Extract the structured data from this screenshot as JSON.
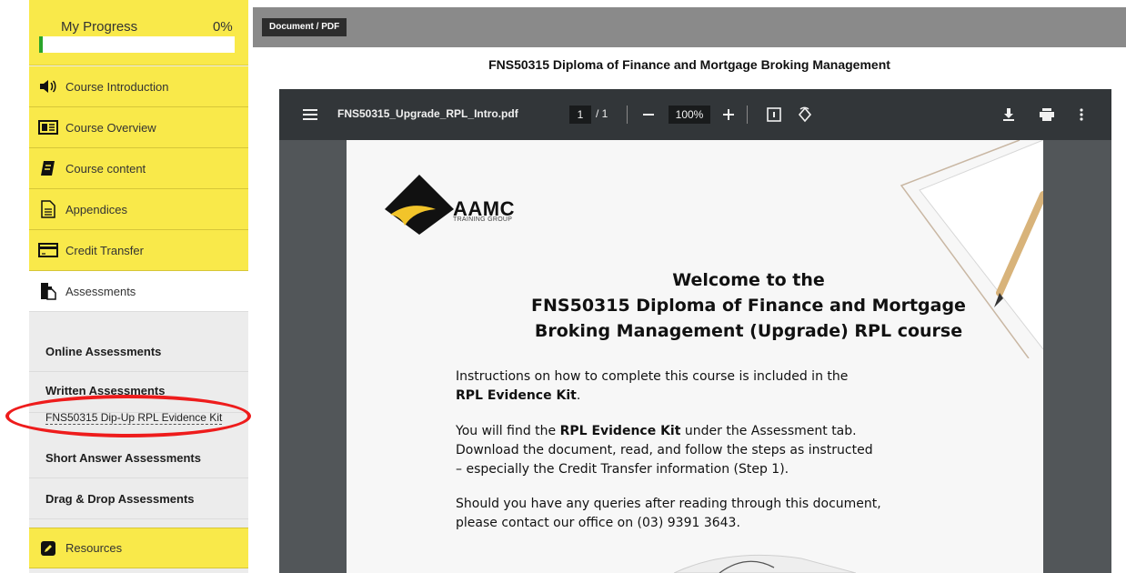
{
  "progress": {
    "title": "My Progress",
    "percent_label": "0%",
    "percent": 0
  },
  "menu": [
    {
      "label": "Course Introduction",
      "icon": "speaker-icon"
    },
    {
      "label": "Course Overview",
      "icon": "newspaper-icon"
    },
    {
      "label": "Course content",
      "icon": "book-icon"
    },
    {
      "label": "Appendices",
      "icon": "document-icon"
    },
    {
      "label": "Credit Transfer",
      "icon": "credit-card-icon"
    },
    {
      "label": "Assessments",
      "icon": "assessment-icon"
    }
  ],
  "assessments": {
    "online": "Online Assessments",
    "written": "Written Assessments",
    "written_link": "FNS50315 Dip-Up RPL Evidence Kit",
    "short_answer": "Short Answer Assessments",
    "drag_drop": "Drag & Drop Assessments"
  },
  "resources": {
    "label": "Resources",
    "icon": "pencil-icon"
  },
  "topbar": {
    "tab_label": "Document / PDF"
  },
  "document_title": "FNS50315 Diploma of Finance and Mortgage Broking Management",
  "pdf_viewer": {
    "file_name": "FNS50315_Upgrade_RPL_Intro.pdf",
    "page_current": "1",
    "page_total": "/ 1",
    "zoom": "100%"
  },
  "pdf_page": {
    "logo_text": "AAMC",
    "logo_sub": "TRAINING GROUP",
    "heading_line1": "Welcome to the",
    "heading_line2": "FNS50315 Diploma of Finance and Mortgage",
    "heading_line3": "Broking Management (Upgrade) RPL course",
    "p1_a": "Instructions on how to complete this course is included in the",
    "p1_b": "RPL Evidence Kit",
    "p1_c": ".",
    "p2_a": "You will find the ",
    "p2_b": "RPL Evidence Kit",
    "p2_c": " under the Assessment tab.",
    "p2_d": "Download the document, read, and follow the steps as instructed",
    "p2_e": "– especially the Credit Transfer information (Step 1).",
    "p3_a": "Should you have any queries after reading through this document,",
    "p3_b": "please contact our office on (03) 9391 3643."
  },
  "colors": {
    "accent_yellow": "#f9e94a",
    "highlight_red": "#ee1c1c",
    "progress_green": "#2aa52a"
  }
}
